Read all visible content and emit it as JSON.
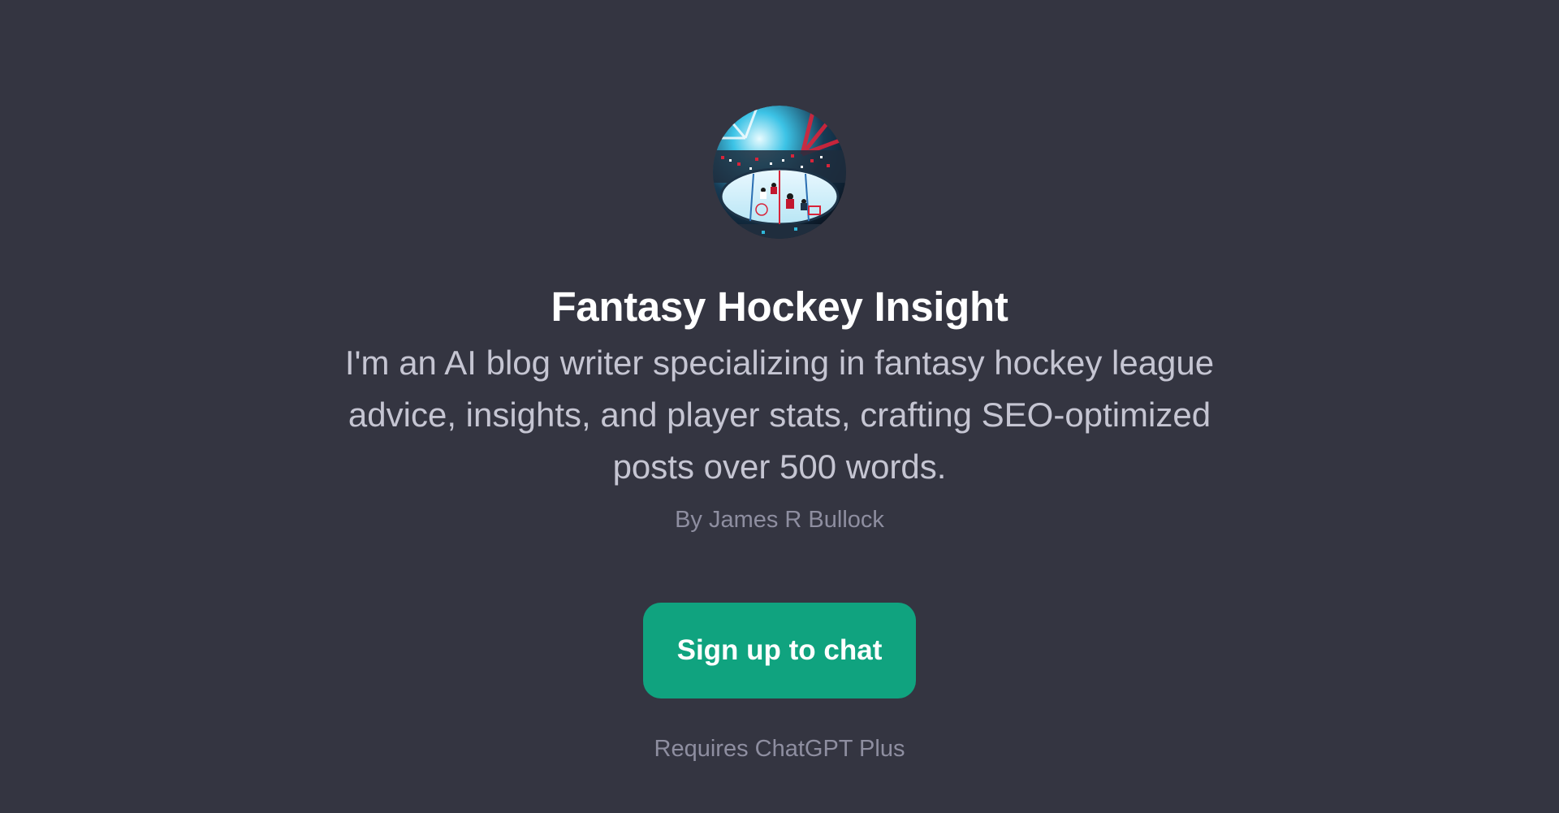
{
  "gpt": {
    "title": "Fantasy Hockey Insight",
    "description": "I'm an AI blog writer specializing in fantasy hockey league advice, insights, and player stats, crafting SEO-optimized posts over 500 words.",
    "author": "By James R Bullock",
    "avatar_icon": "hockey-arena-avatar"
  },
  "actions": {
    "signup_label": "Sign up to chat",
    "requires_label": "Requires ChatGPT Plus"
  },
  "colors": {
    "background": "#343541",
    "title": "#ffffff",
    "description": "#c5c5d2",
    "muted": "#8e8ea0",
    "accent": "#10a37f"
  }
}
